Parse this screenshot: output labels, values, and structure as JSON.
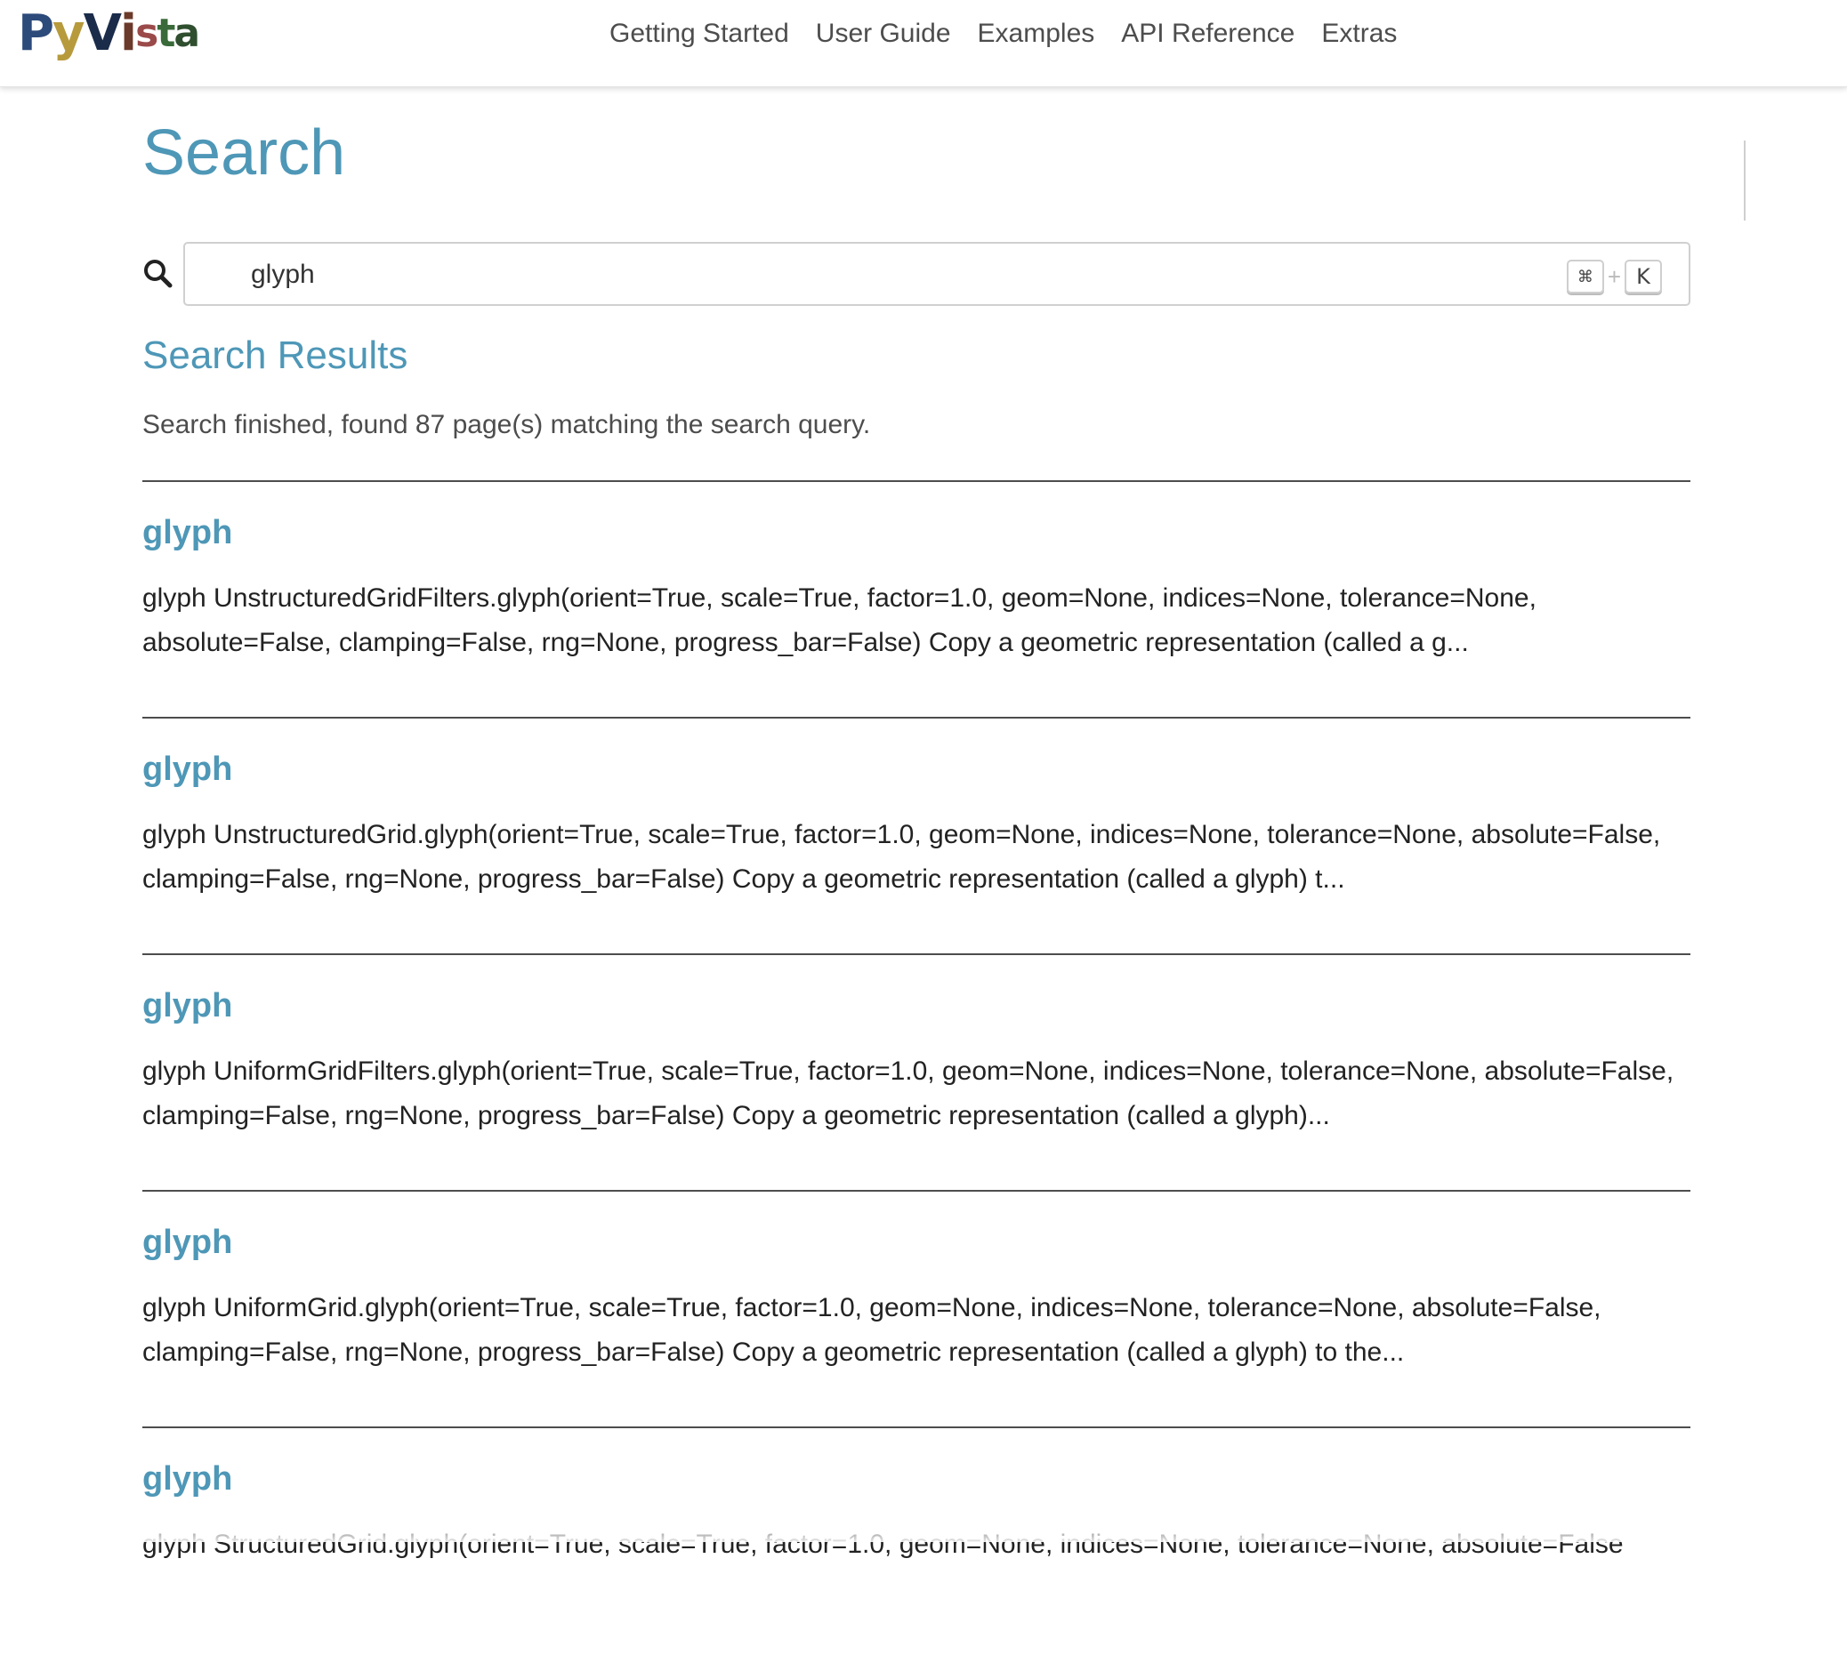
{
  "navbar": {
    "logo_text": "PyVista",
    "links": [
      {
        "label": "Getting Started"
      },
      {
        "label": "User Guide"
      },
      {
        "label": "Examples"
      },
      {
        "label": "API Reference"
      },
      {
        "label": "Extras"
      }
    ]
  },
  "page": {
    "title": "Search"
  },
  "search": {
    "value": "glyph",
    "icon": "search-icon",
    "shortcut_cmd": "⌘",
    "shortcut_plus": "+",
    "shortcut_key": "K"
  },
  "results": {
    "heading": "Search Results",
    "summary": "Search finished, found 87 page(s) matching the search query.",
    "items": [
      {
        "title": "glyph",
        "snippet": "glyph UnstructuredGridFilters.glyph(orient=True, scale=True, factor=1.0, geom=None, indices=None, tolerance=None, absolute=False, clamping=False, rng=None, progress_bar=False) Copy a geometric representation (called a g..."
      },
      {
        "title": "glyph",
        "snippet": "glyph UnstructuredGrid.glyph(orient=True, scale=True, factor=1.0, geom=None, indices=None, tolerance=None, absolute=False, clamping=False, rng=None, progress_bar=False) Copy a geometric representation (called a glyph) t..."
      },
      {
        "title": "glyph",
        "snippet": "glyph UniformGridFilters.glyph(orient=True, scale=True, factor=1.0, geom=None, indices=None, tolerance=None, absolute=False, clamping=False, rng=None, progress_bar=False) Copy a geometric representation (called a glyph)..."
      },
      {
        "title": "glyph",
        "snippet": "glyph UniformGrid.glyph(orient=True, scale=True, factor=1.0, geom=None, indices=None, tolerance=None, absolute=False, clamping=False, rng=None, progress_bar=False) Copy a geometric representation (called a glyph) to the..."
      },
      {
        "title": "glyph",
        "snippet": "glyph StructuredGrid.glyph(orient=True, scale=True, factor=1.0, geom=None, indices=None, tolerance=None, absolute=False"
      }
    ]
  },
  "colors": {
    "accent": "#4e97b7",
    "text": "#222222",
    "muted": "#4d4d4d"
  }
}
